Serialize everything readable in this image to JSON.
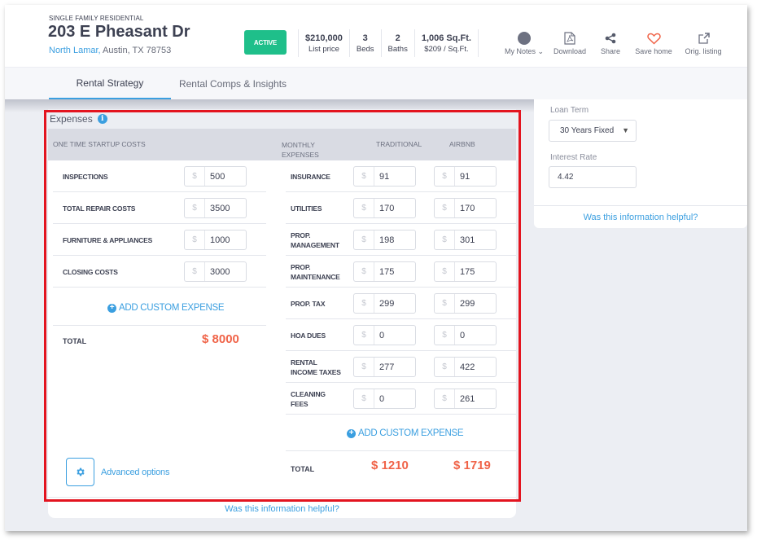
{
  "header": {
    "property_type": "SINGLE FAMILY RESIDENTIAL",
    "address": "203 E Pheasant Dr",
    "neighborhood": "North Lamar,",
    "city_state_zip": " Austin, TX 78753",
    "status_badge": "ACTIVE",
    "status_color": "#1fbf8a",
    "stats": [
      {
        "value": "$210,000",
        "label": "List price"
      },
      {
        "value": "3",
        "label": "Beds"
      },
      {
        "value": "2",
        "label": "Baths"
      },
      {
        "value": "1,006 Sq.Ft.",
        "label": "$209 / Sq.Ft."
      }
    ],
    "actions": [
      {
        "label": "My Notes ⌄",
        "icon": "notes-avatar-icon"
      },
      {
        "label": "Download",
        "icon": "pdf-download-icon"
      },
      {
        "label": "Share",
        "icon": "share-icon"
      },
      {
        "label": "Save home",
        "icon": "heart-icon"
      },
      {
        "label": "Orig. listing",
        "icon": "external-link-icon"
      }
    ]
  },
  "tabs": [
    {
      "label": "Rental Strategy",
      "active": true
    },
    {
      "label": "Rental Comps & Insights",
      "active": false
    }
  ],
  "right_panel": {
    "loan_term_label": "Loan Term",
    "loan_term_value": "30 Years Fixed",
    "interest_rate_label": "Interest Rate",
    "interest_rate_value": "4.42",
    "helpful_link": "Was this information helpful?"
  },
  "expenses": {
    "title": "Expenses",
    "startup": {
      "header": "ONE TIME STARTUP COSTS",
      "currency": "$",
      "items": [
        {
          "label": "INSPECTIONS",
          "value": "500"
        },
        {
          "label": "TOTAL REPAIR COSTS",
          "value": "3500"
        },
        {
          "label": "FURNITURE & APPLIANCES",
          "value": "1000"
        },
        {
          "label": "CLOSING COSTS",
          "value": "3000"
        }
      ],
      "add_label": "ADD CUSTOM EXPENSE",
      "total_label": "TOTAL",
      "total_value": "$ 8000"
    },
    "monthly": {
      "header_line1": "MONTHLY",
      "header_line2": "EXPENSES",
      "col_traditional": "TRADITIONAL",
      "col_airbnb": "AIRBNB",
      "currency": "$",
      "items": [
        {
          "label1": "INSURANCE",
          "label2": "",
          "traditional": "91",
          "airbnb": "91"
        },
        {
          "label1": "UTILITIES",
          "label2": "",
          "traditional": "170",
          "airbnb": "170"
        },
        {
          "label1": "PROP.",
          "label2": "MANAGEMENT",
          "traditional": "198",
          "airbnb": "301"
        },
        {
          "label1": "PROP.",
          "label2": "MAINTENANCE",
          "traditional": "175",
          "airbnb": "175"
        },
        {
          "label1": "PROP. TAX",
          "label2": "",
          "traditional": "299",
          "airbnb": "299"
        },
        {
          "label1": "HOA DUES",
          "label2": "",
          "traditional": "0",
          "airbnb": "0"
        },
        {
          "label1": "RENTAL",
          "label2": "INCOME TAXES",
          "traditional": "277",
          "airbnb": "422"
        },
        {
          "label1": "CLEANING",
          "label2": "FEES",
          "traditional": "0",
          "airbnb": "261"
        }
      ],
      "add_label": "ADD CUSTOM EXPENSE",
      "total_label": "TOTAL",
      "total_traditional": "$ 1210",
      "total_airbnb": "$ 1719"
    },
    "advanced_options": "Advanced options",
    "helpful_link": "Was this information helpful?",
    "total_color": "#f06449",
    "accent_color": "#3b9fe0"
  }
}
